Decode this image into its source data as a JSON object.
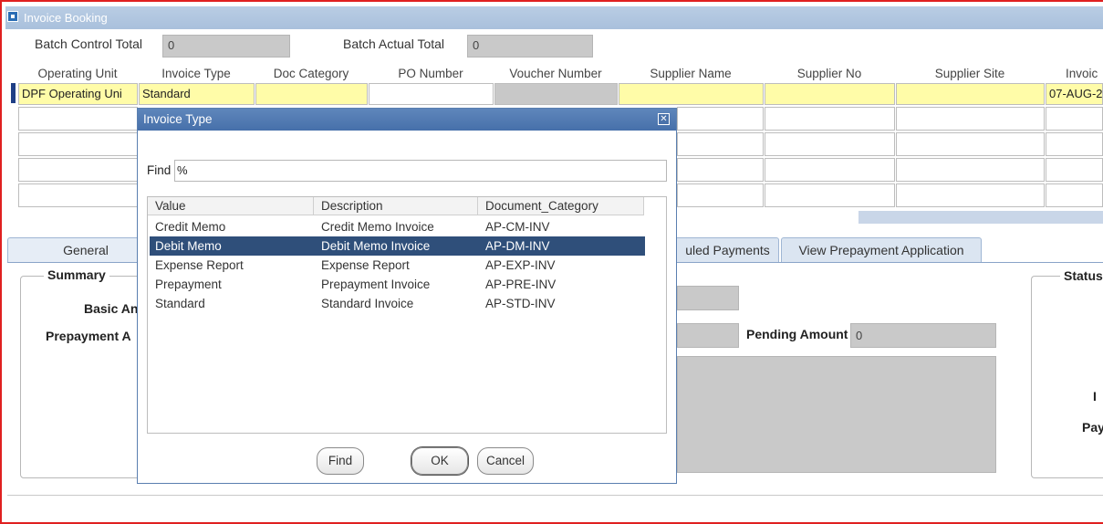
{
  "window": {
    "title": "Invoice Booking"
  },
  "batch": {
    "control_label": "Batch Control Total",
    "control_value": "0",
    "actual_label": "Batch Actual Total",
    "actual_value": "0"
  },
  "grid": {
    "columns": [
      "Operating Unit",
      "Invoice Type",
      "Doc Category",
      "PO Number",
      "Voucher Number",
      "Supplier Name",
      "Supplier No",
      "Supplier Site",
      "Invoic"
    ],
    "row1": {
      "operating_unit": "DPF Operating Uni",
      "invoice_type": "Standard",
      "invoice_date": "07-AUG-2"
    }
  },
  "tabs": {
    "general": "General",
    "scheduled": "uled Payments",
    "prepayment": "View Prepayment Application"
  },
  "form": {
    "summary_title": "Summary",
    "basic_amount_label": "Basic An",
    "prepayment_label": "Prepayment A",
    "pending_amount_label": "Pending Amount",
    "pending_amount_value": "0",
    "status_title": "Status",
    "right_label_1": "I",
    "right_label_2": "Pay"
  },
  "dialog": {
    "title": "Invoice Type",
    "close_glyph": "✕",
    "find_label": "Find",
    "find_value": "%",
    "columns": [
      "Value",
      "Description",
      "Document_Category"
    ],
    "rows": [
      {
        "value": "Credit Memo",
        "description": "Credit Memo Invoice",
        "category": "AP-CM-INV"
      },
      {
        "value": "Debit Memo",
        "description": "Debit Memo Invoice",
        "category": "AP-DM-INV"
      },
      {
        "value": "Expense Report",
        "description": "Expense Report",
        "category": "AP-EXP-INV"
      },
      {
        "value": "Prepayment",
        "description": "Prepayment Invoice",
        "category": "AP-PRE-INV"
      },
      {
        "value": "Standard",
        "description": "Standard Invoice",
        "category": "AP-STD-INV"
      }
    ],
    "selected_index": 1,
    "buttons": {
      "find": "Find",
      "ok": "OK",
      "cancel": "Cancel"
    }
  },
  "colors": {
    "selection": "#2f4f7a",
    "required_field": "#fffca8",
    "title_bar": "#4670aa"
  }
}
